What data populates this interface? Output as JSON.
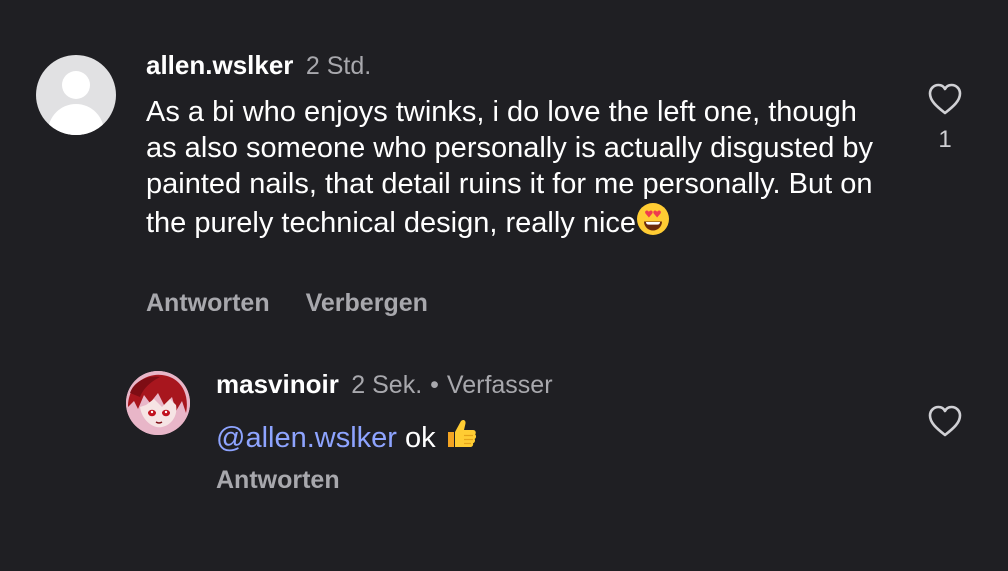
{
  "comment": {
    "username": "allen.wslker",
    "timestamp": "2 Std.",
    "text": "As a bi who enjoys twinks, i do love the left one, though as also someone who personally is actually disgusted by painted nails, that detail ruins it for me personally. But on the purely technical design, really nice",
    "trailing_emoji": "heart-eyes-emoji",
    "reply_label": "Antworten",
    "hide_label": "Verbergen",
    "like_count": "1",
    "like_icon": "heart-outline-icon",
    "avatar": "default-avatar"
  },
  "reply": {
    "username": "masvinoir",
    "timestamp": "2 Sek.",
    "separator": "•",
    "author_label": "Verfasser",
    "mention": "@allen.wslker",
    "text": "ok",
    "trailing_emoji": "thumbs-up-emoji",
    "reply_label": "Antworten",
    "like_icon": "heart-outline-icon",
    "avatar": "anime-avatar"
  },
  "colors": {
    "background": "#1f1f23",
    "primary_text": "#ffffff",
    "secondary_text": "#a8a8ad",
    "mention": "#8ea4ff"
  }
}
